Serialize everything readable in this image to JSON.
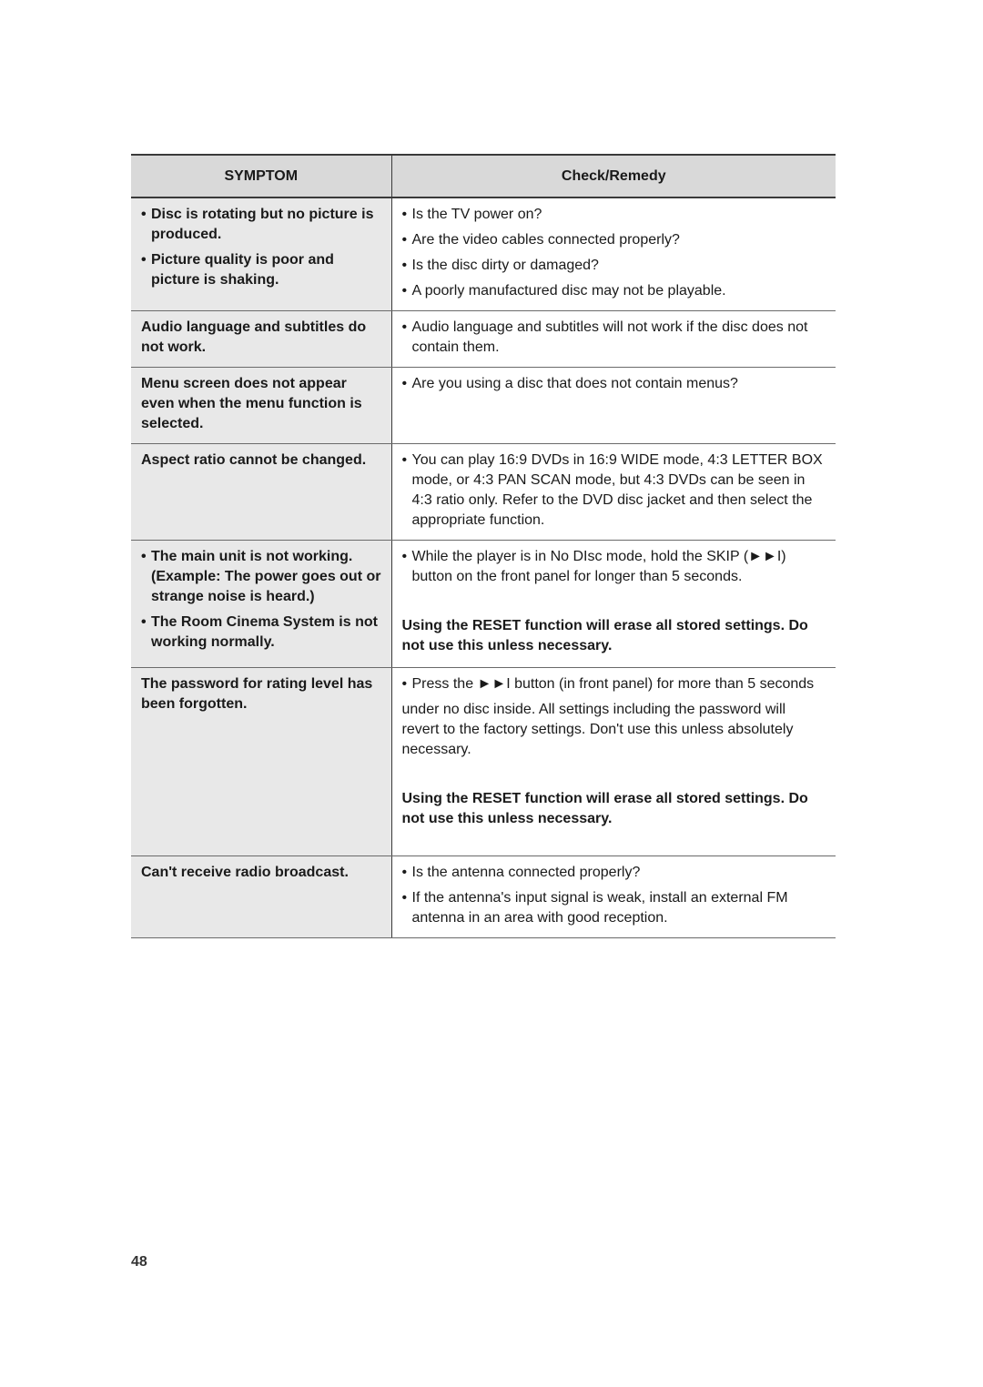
{
  "header": {
    "symptom": "SYMPTOM",
    "remedy": "Check/Remedy"
  },
  "bullet": "•",
  "rows": [
    {
      "symptoms": [
        "Disc is rotating but no picture is produced.",
        "Picture quality is poor and picture is shaking."
      ],
      "remedies": [
        "Is the TV power on?",
        "Are the video cables connected properly?",
        "Is the disc dirty or damaged?",
        "A poorly manufactured disc may not be playable."
      ]
    },
    {
      "symptom": "Audio language and subtitles do not work.",
      "remedies": [
        "Audio language and subtitles will not work if the disc does not contain them."
      ]
    },
    {
      "symptom": "Menu screen does not appear even when the menu function is selected.",
      "remedies": [
        "Are you using a disc that does not contain menus?"
      ]
    },
    {
      "symptom": "Aspect ratio cannot be changed.",
      "remedies": [
        "You can play 16:9 DVDs in 16:9 WIDE mode, 4:3 LETTER BOX mode, or 4:3 PAN SCAN mode, but 4:3 DVDs can be seen in 4:3 ratio only. Refer to the DVD disc jacket and then select the appropriate function."
      ]
    },
    {
      "symptoms": [
        "The main unit is not working. (Example: The power goes out or strange noise is heard.)",
        "The Room Cinema System is not working normally."
      ],
      "remedies": [
        "While the player is in No DIsc mode, hold the SKIP (►►I) button on the front panel for longer than 5 seconds."
      ],
      "warning": "Using the RESET function will erase all stored settings. Do not use this unless necessary."
    },
    {
      "symptom": "The password for rating level has been forgotten.",
      "remedies": [
        "Press the ►►I button (in front panel) for more than 5 seconds"
      ],
      "note": "under no disc inside. All settings including the password will revert to the factory settings. Don't use this unless absolutely necessary.",
      "warning": "Using the RESET function will erase all stored settings. Do not use this unless necessary."
    },
    {
      "symptom": "Can't receive radio broadcast.",
      "remedies": [
        "Is the antenna connected properly?",
        "If the antenna's input signal is weak, install an external FM antenna in an area with good reception."
      ]
    }
  ],
  "page_number": "48"
}
